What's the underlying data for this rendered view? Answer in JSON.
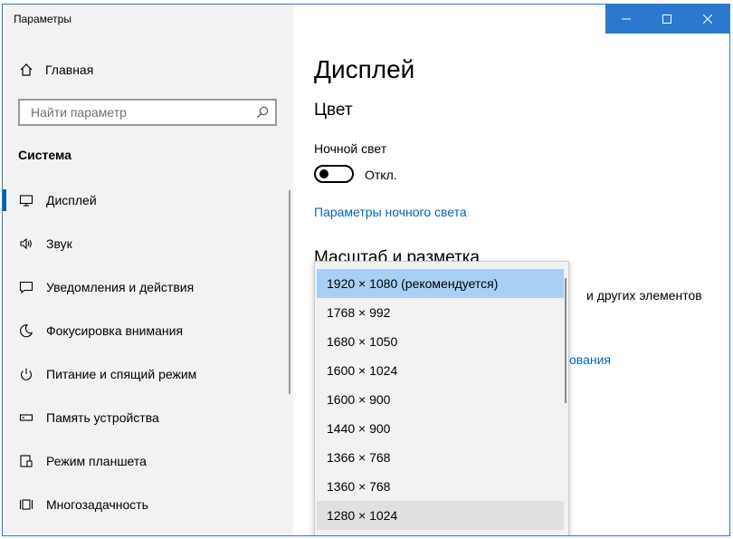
{
  "window": {
    "title": "Параметры",
    "controls": [
      "minimize",
      "maximize",
      "close"
    ],
    "accent": "#2b78d1"
  },
  "sidebar": {
    "home_label": "Главная",
    "search_placeholder": "Найти параметр",
    "section_title": "Система",
    "items": [
      {
        "label": "Дисплей",
        "icon": "monitor-icon",
        "active": true
      },
      {
        "label": "Звук",
        "icon": "speaker-icon",
        "active": false
      },
      {
        "label": "Уведомления и действия",
        "icon": "notification-icon",
        "active": false
      },
      {
        "label": "Фокусировка внимания",
        "icon": "moon-icon",
        "active": false
      },
      {
        "label": "Питание и спящий режим",
        "icon": "power-icon",
        "active": false
      },
      {
        "label": "Память устройства",
        "icon": "storage-icon",
        "active": false
      },
      {
        "label": "Режим планшета",
        "icon": "tablet-mode-icon",
        "active": false
      },
      {
        "label": "Многозадачность",
        "icon": "multitasking-icon",
        "active": false
      }
    ]
  },
  "main": {
    "title": "Дисплей",
    "color_heading": "Цвет",
    "night_light_label": "Ночной свет",
    "night_light_state": "Откл.",
    "night_light_link": "Параметры ночного света",
    "scale_heading": "Масштаб и разметка",
    "scale_desc_partial": "и других элементов",
    "advanced_link_partial": "ования"
  },
  "resolution_dropdown": {
    "options": [
      "1920 × 1080 (рекомендуется)",
      "1768 × 992",
      "1680 × 1050",
      "1600 × 1024",
      "1600 × 900",
      "1440 × 900",
      "1366 × 768",
      "1360 × 768",
      "1280 × 1024"
    ],
    "selected": "1920 × 1080 (рекомендуется)"
  },
  "colors": {
    "link": "#0067b8",
    "selection": "#a8d0f5",
    "active_indicator": "#0063b1",
    "close_button": "#e81123"
  }
}
